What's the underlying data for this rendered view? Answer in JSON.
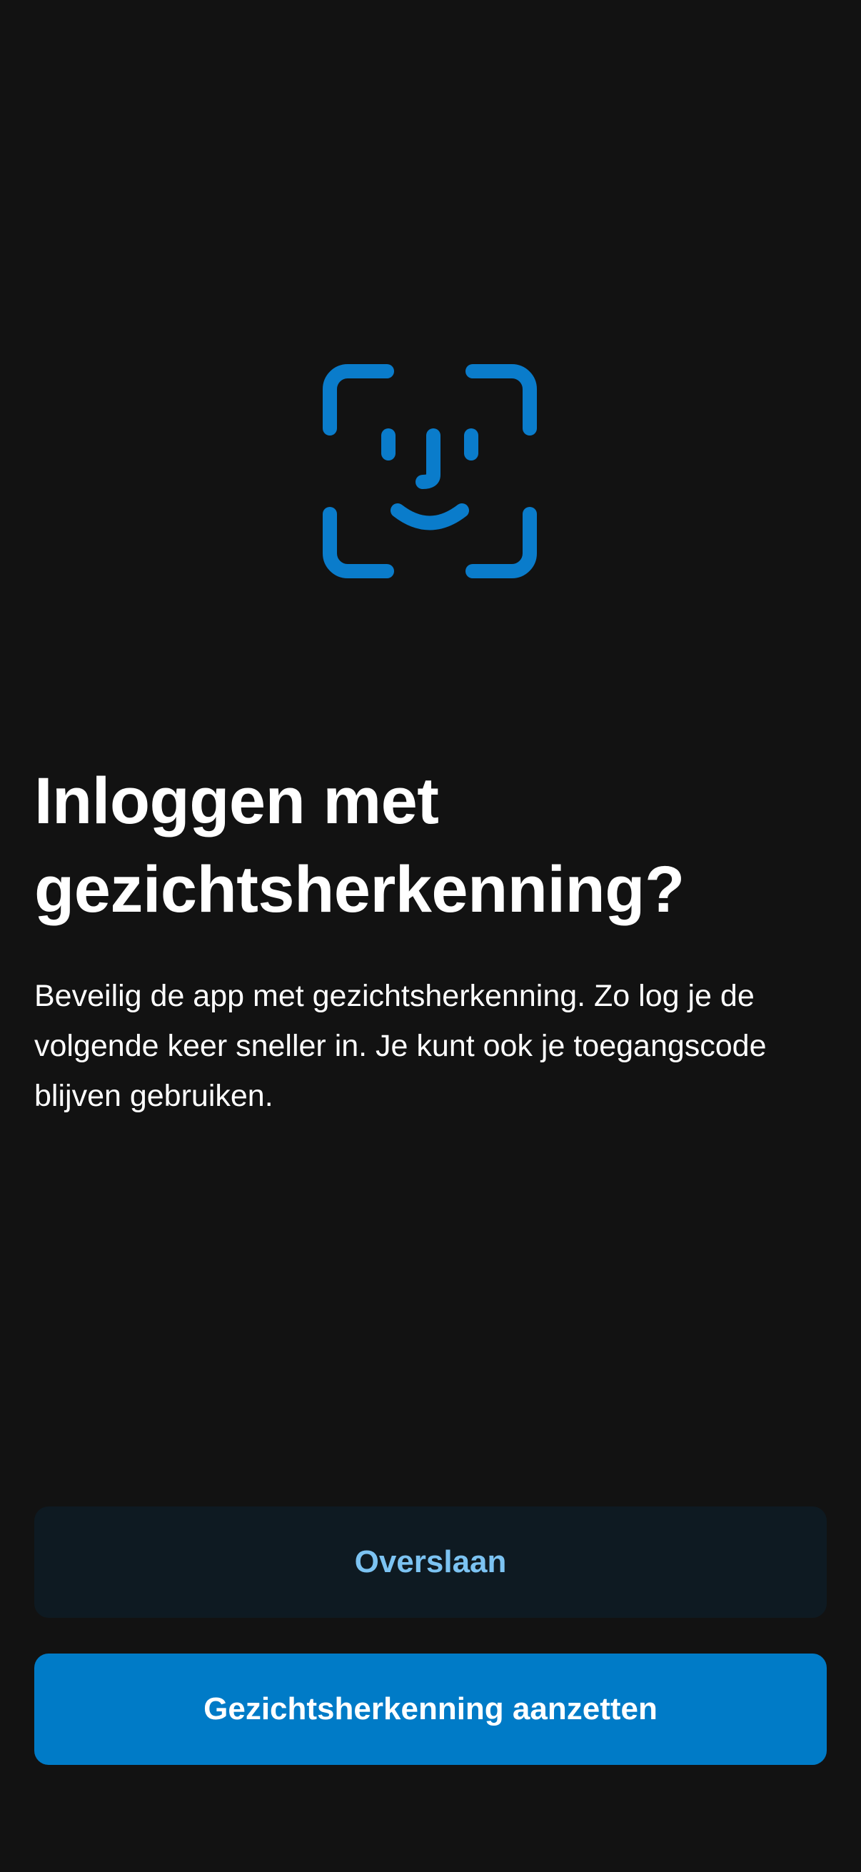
{
  "icon": {
    "name": "face-id-icon",
    "color": "#0a7ccb"
  },
  "heading": {
    "title": "Inloggen met gezichtsherkenning?"
  },
  "description": {
    "text": "Beveilig de app met gezichtsherkenning. Zo log je de volgende keer sneller in. Je kunt ook je toegangscode blijven gebruiken."
  },
  "actions": {
    "skip_label": "Overslaan",
    "enable_label": "Gezichtsherkenning aanzetten"
  },
  "colors": {
    "background": "#121212",
    "primary_button": "#007bc7",
    "secondary_button": "#0e1a22",
    "secondary_text": "#7cc3f2"
  }
}
